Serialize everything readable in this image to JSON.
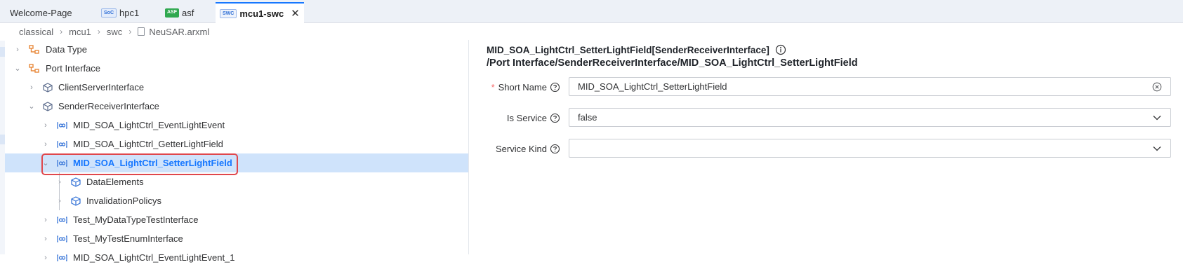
{
  "tabs": [
    {
      "label": "Welcome-Page",
      "badge": ""
    },
    {
      "label": "hpc1",
      "badge": "SoC"
    },
    {
      "label": "asf",
      "badge": "ASF"
    },
    {
      "label": "mcu1-swc",
      "badge": "SWC"
    }
  ],
  "breadcrumb": [
    "classical",
    "mcu1",
    "swc",
    "NeuSAR.arxml"
  ],
  "tree": [
    "Data Type",
    "Port Interface",
    "ClientServerInterface",
    "SenderReceiverInterface",
    "MID_SOA_LightCtrl_EventLightEvent",
    "MID_SOA_LightCtrl_GetterLightField",
    "MID_SOA_LightCtrl_SetterLightField",
    "DataElements",
    "InvalidationPolicys",
    "Test_MyDataTypeTestInterface",
    "Test_MyTestEnumInterface",
    "MID_SOA_LightCtrl_EventLightEvent_1"
  ],
  "detail": {
    "title": "MID_SOA_LightCtrl_SetterLightField[SenderReceiverInterface]",
    "path": "/Port Interface/SenderReceiverInterface/MID_SOA_LightCtrl_SetterLightField",
    "short_name_label": "Short Name",
    "short_name_value": "MID_SOA_LightCtrl_SetterLightField",
    "is_service_label": "Is Service",
    "is_service_value": "false",
    "service_kind_label": "Service Kind",
    "service_kind_value": "",
    "required_mark": "*"
  },
  "icons": {
    "tab_close": "close-icon",
    "file": "file-icon",
    "folder": "hierarchy-icon",
    "interface": "box-icon",
    "sr_element": "link-icon",
    "info": "info-icon",
    "help": "question-icon",
    "clear": "clear-icon",
    "dropdown": "chevron-down-icon"
  },
  "colors": {
    "accent": "#1677ff",
    "selected_bg": "#cfe3fb",
    "highlight_border": "#e0474c",
    "required": "#f56c6c",
    "folder_icon": "#e8883a",
    "interface_icon": "#5b6b8c",
    "sr_icon": "#2f6fd6"
  }
}
